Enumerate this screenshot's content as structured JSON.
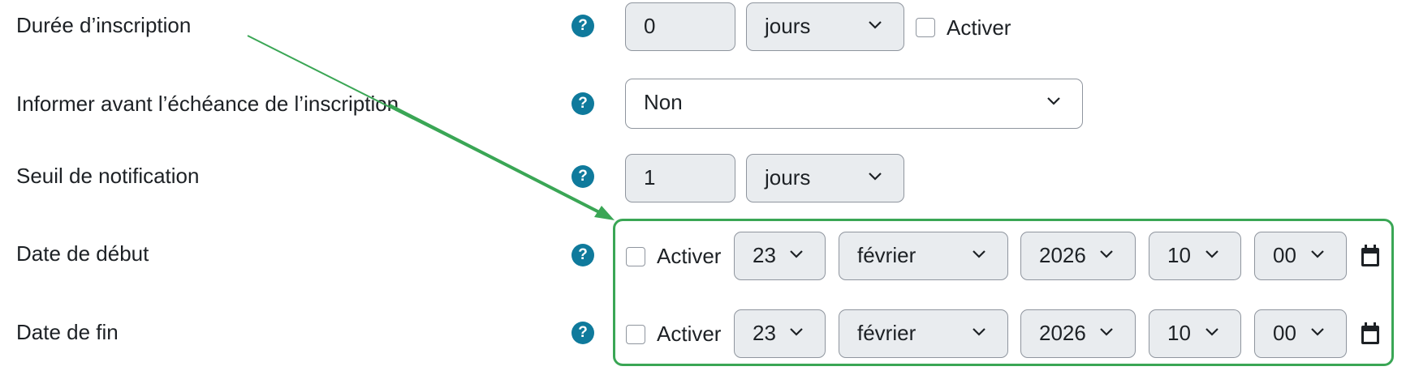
{
  "colors": {
    "accent": "#0f7a9c",
    "annotation": "#3aa655",
    "field_bg": "#e9ecef",
    "border": "#8f959e"
  },
  "rows": {
    "duree": {
      "label": "Durée d’inscription",
      "value": "0",
      "unit": "jours",
      "enable_label": "Activer"
    },
    "informer": {
      "label": "Informer avant l’échéance de l’inscription",
      "value": "Non"
    },
    "seuil": {
      "label": "Seuil de notification",
      "value": "1",
      "unit": "jours"
    },
    "debut": {
      "label": "Date de début",
      "enable_label": "Activer",
      "day": "23",
      "month": "février",
      "year": "2026",
      "hour": "10",
      "minute": "00"
    },
    "fin": {
      "label": "Date de fin",
      "enable_label": "Activer",
      "day": "23",
      "month": "février",
      "year": "2026",
      "hour": "10",
      "minute": "00"
    }
  },
  "help_glyph": "?",
  "icons": {
    "help": "help-icon",
    "calendar": "calendar-icon",
    "dropdown": "chevron-down-icon"
  }
}
